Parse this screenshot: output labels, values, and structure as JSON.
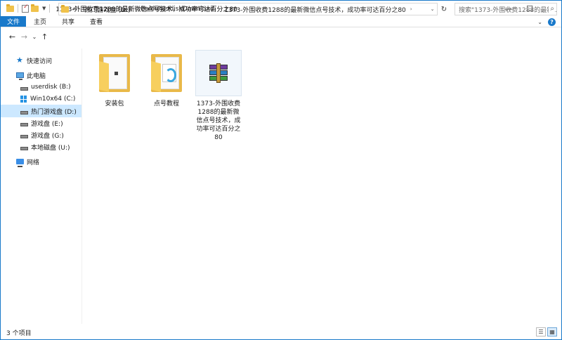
{
  "window": {
    "title": "1373-外围收费1288的最新微信点号技术，成功率可达百分之80",
    "controls": {
      "minimize": "—",
      "maximize": "☐",
      "close": "✕"
    }
  },
  "ribbon": {
    "tabs": [
      "文件",
      "主页",
      "共享",
      "查看"
    ]
  },
  "nav": {
    "back": "←",
    "forward": "→",
    "recent": "⌄",
    "up": "↑",
    "breadcrumb_prefix": "«",
    "breadcrumb": [
      "热门游戏盘 (D:)",
      "BaiduNetdiskDownload",
      "1373-外围收费1288的最新微信点号技术，成功率可达百分之80"
    ],
    "search_placeholder": "搜索\"1373-外围收费1288的最新...",
    "refresh": "↻",
    "dropdown": "⌄"
  },
  "sidebar": {
    "items": [
      {
        "label": "快速访问",
        "icon": "star-icon"
      },
      {
        "label": "此电脑",
        "icon": "computer-icon"
      },
      {
        "label": "userdisk (B:)",
        "icon": "drive-icon"
      },
      {
        "label": "Win10x64 (C:)",
        "icon": "windows-drive-icon"
      },
      {
        "label": "热门游戏盘 (D:)",
        "icon": "drive-icon",
        "selected": true
      },
      {
        "label": "游戏盘 (E:)",
        "icon": "drive-icon"
      },
      {
        "label": "游戏盘 (G:)",
        "icon": "drive-icon"
      },
      {
        "label": "本地磁盘 (U:)",
        "icon": "drive-icon"
      },
      {
        "label": "网络",
        "icon": "network-icon"
      }
    ]
  },
  "files": [
    {
      "name": "安装包",
      "type": "folder"
    },
    {
      "name": "点号教程",
      "type": "folder"
    },
    {
      "name": "1373-外围收费1288的最新微信点号技术，成功率可达百分之80",
      "type": "rar-archive"
    }
  ],
  "status": {
    "count": "3 个项目",
    "views": [
      "details-view-icon",
      "large-icons-view-icon"
    ]
  }
}
